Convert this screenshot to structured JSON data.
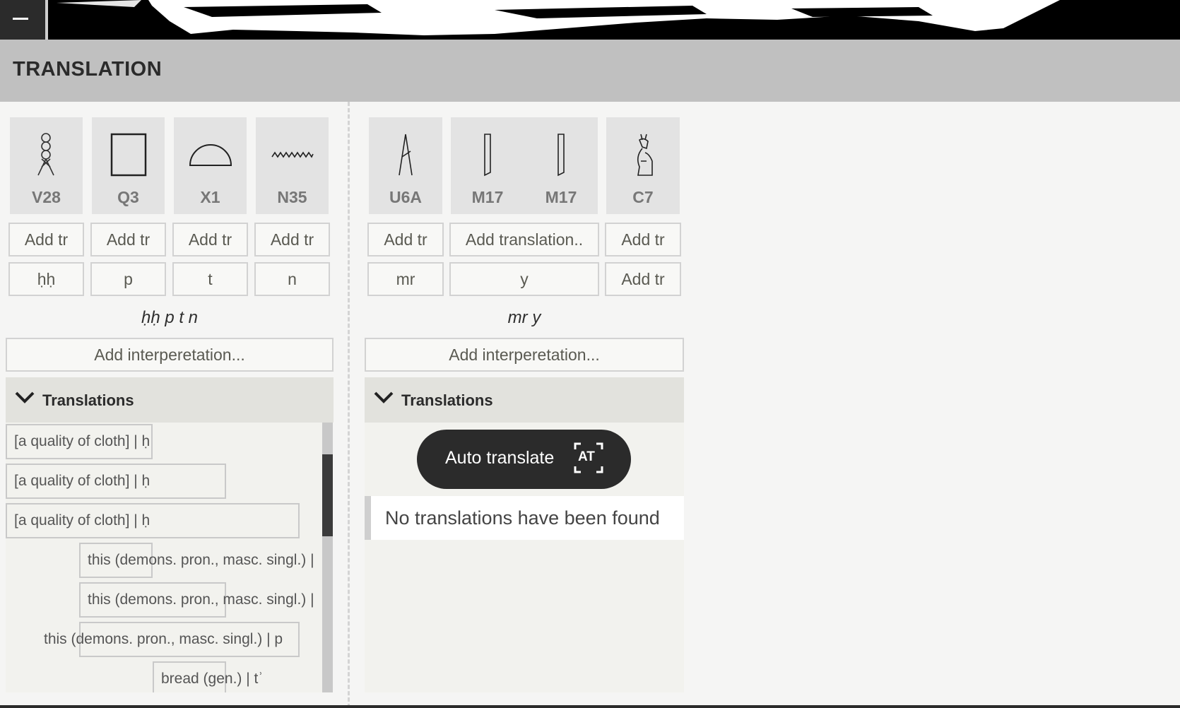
{
  "header": {
    "title": "TRANSLATION"
  },
  "words": [
    {
      "glyphs": [
        {
          "code": "V28",
          "icon": "twisted-flax-wick-glyph-icon"
        },
        {
          "code": "Q3",
          "icon": "stool-square-glyph-icon"
        },
        {
          "code": "X1",
          "icon": "bread-loaf-glyph-icon"
        },
        {
          "code": "N35",
          "icon": "water-ripple-glyph-icon"
        }
      ],
      "translation_placeholders": [
        "Add tr",
        "Add tr",
        "Add tr",
        "Add tr"
      ],
      "sign_values": [
        "ḥḥ",
        "p",
        "t",
        "n"
      ],
      "transliteration": "ḥḥ p t n",
      "interpretation_placeholder": "Add interperetation...",
      "translations_label": "Translations",
      "translations": [
        "[a quality of cloth] | ḥ",
        "[a quality of cloth] | ḥ",
        "[a quality of cloth] | ḥ",
        "this (demons. pron., masc. singl.) |",
        "this (demons. pron., masc. singl.) |",
        "this (demons. pron., masc. singl.) | p",
        "bread (gen.) | tʾ"
      ]
    },
    {
      "glyphs": [
        {
          "code": "U6A",
          "icon": "hoe-glyph-icon"
        },
        {
          "code": "M17",
          "icon": "reed-leaf-glyph-icon"
        },
        {
          "code": "M17",
          "icon": "reed-leaf-glyph-icon"
        },
        {
          "code": "C7",
          "icon": "seth-deity-glyph-icon"
        }
      ],
      "translation_placeholders": [
        "Add tr",
        "Add translation..",
        "Add tr"
      ],
      "sign_values": [
        "mr",
        "y",
        "Add tr"
      ],
      "transliteration": "mr y",
      "interpretation_placeholder": "Add interperetation...",
      "translations_label": "Translations",
      "auto_translate_label": "Auto translate",
      "auto_translate_icon_text": "AT",
      "empty_message": "No translations have been found"
    }
  ]
}
